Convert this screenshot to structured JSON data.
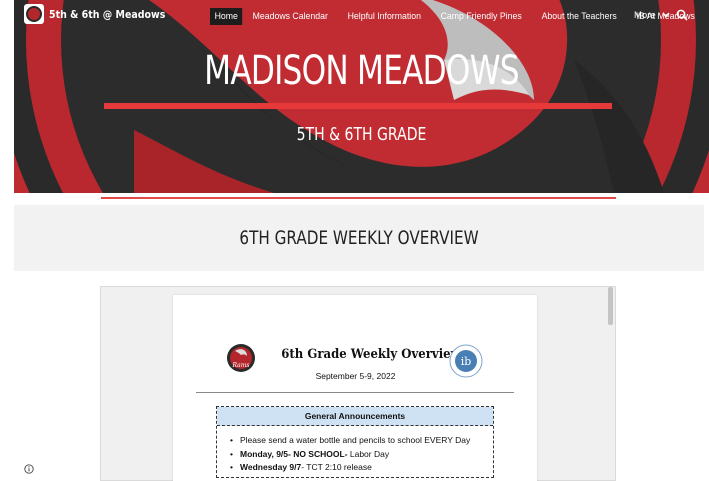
{
  "header": {
    "site_title": "5th & 6th @ Meadows",
    "nav": [
      {
        "label": "Home",
        "active": true
      },
      {
        "label": "Meadows Calendar"
      },
      {
        "label": "Helpful Information"
      },
      {
        "label": "Camp Friendly Pines"
      },
      {
        "label": "About the Teachers"
      },
      {
        "label": "IB At Meadows"
      }
    ],
    "more_label": "More",
    "icons": {
      "more": "chevron-down-icon",
      "search": "search-icon"
    }
  },
  "hero": {
    "title": "MADISON MEADOWS",
    "subtitle": "5TH & 6TH GRADE"
  },
  "section": {
    "title": "6TH GRADE WEEKLY OVERVIEW"
  },
  "document": {
    "title": "6th Grade Weekly Overview",
    "date": "September 5-9, 2022",
    "left_logo_text": "Rams",
    "right_logo_text": "ib",
    "announcements": {
      "heading": "General Announcements",
      "items": [
        {
          "bold": "",
          "text": "Please send a water bottle and pencils to school EVERY Day"
        },
        {
          "bold": "Monday, 9/5- NO SCHOOL-",
          "text": " Labor Day"
        },
        {
          "bold": "Wednesday 9/7",
          "text": "- TCT 2:10 release"
        }
      ]
    }
  },
  "colors": {
    "accent_red": "#e8393a",
    "mascot_red": "#b3262c",
    "dark": "#2b2b2b",
    "announcement_bg": "#cfe2f3"
  }
}
